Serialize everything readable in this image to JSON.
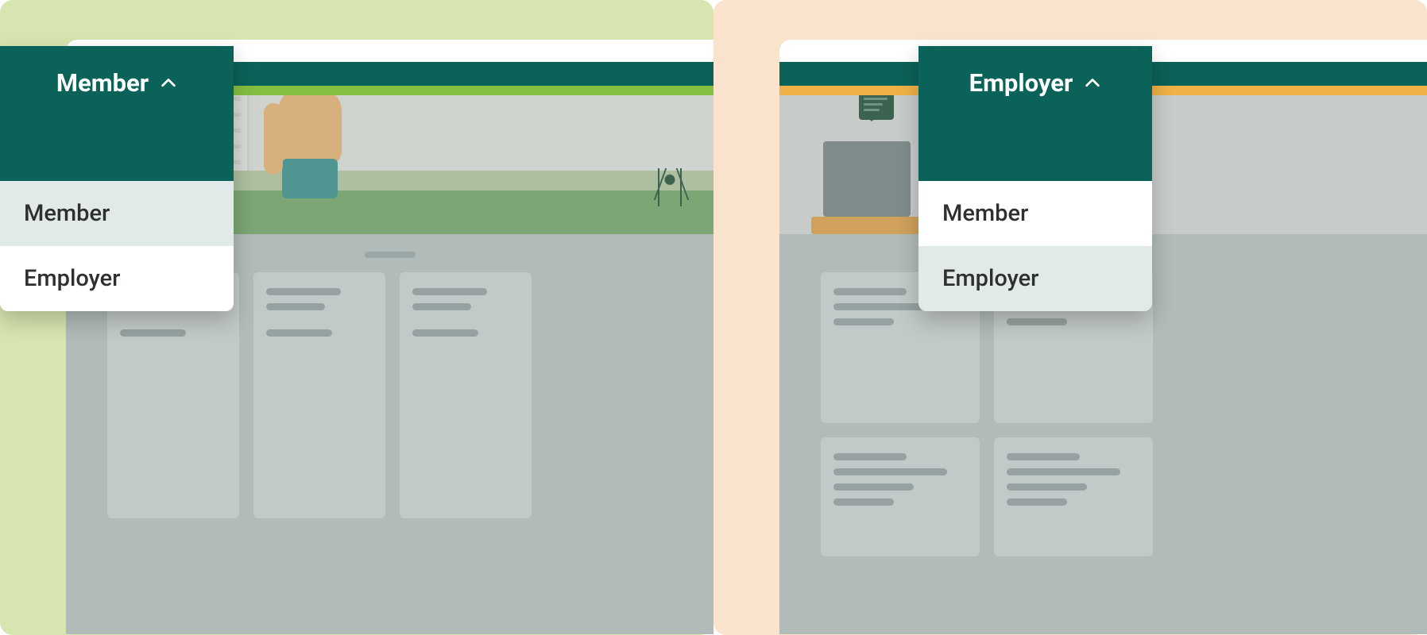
{
  "left": {
    "current_role": "Member",
    "options": [
      "Member",
      "Employer"
    ],
    "selected_index": 0
  },
  "right": {
    "current_role": "Employer",
    "options": [
      "Member",
      "Employer"
    ],
    "selected_index": 1
  },
  "colors": {
    "teal": "#0B6258",
    "accent_green": "#84BF41",
    "accent_orange": "#F0B247"
  }
}
